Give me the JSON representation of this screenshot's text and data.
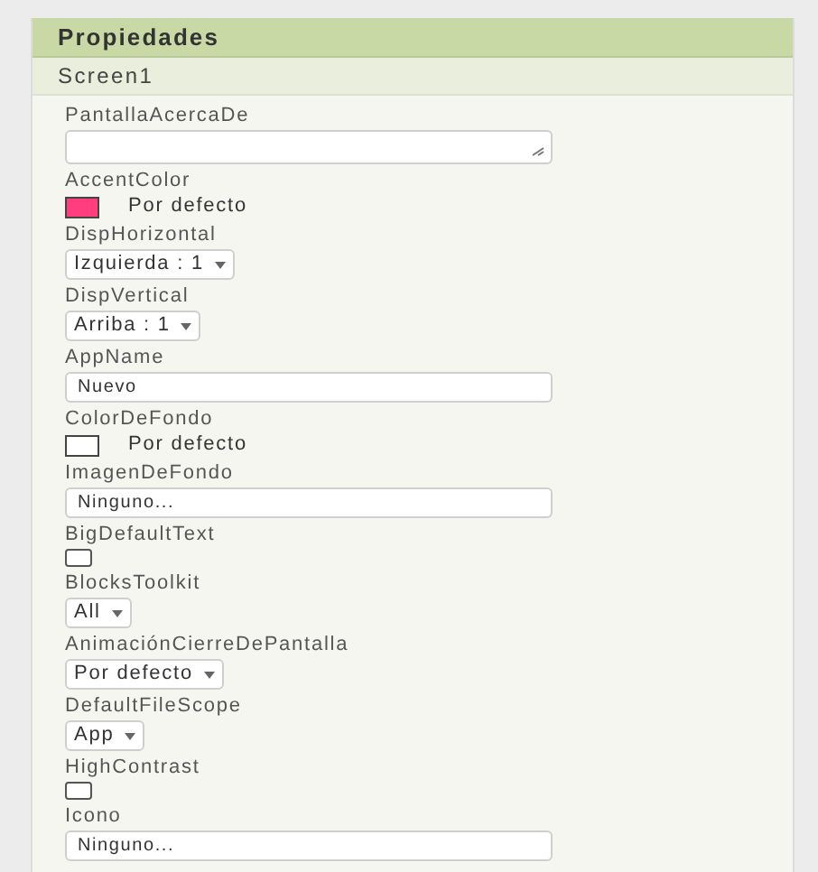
{
  "panel": {
    "title": "Propiedades",
    "component": "Screen1"
  },
  "properties": [
    {
      "kind": "textarea",
      "label": "PantallaAcercaDe"
    },
    {
      "kind": "color",
      "label": "AccentColor",
      "color": "#ff3d7f",
      "value": "Por defecto"
    },
    {
      "kind": "dropdown",
      "label": "DispHorizontal",
      "value": "Izquierda : 1"
    },
    {
      "kind": "dropdown",
      "label": "DispVertical",
      "value": "Arriba : 1"
    },
    {
      "kind": "text",
      "label": "AppName",
      "value": "Nuevo"
    },
    {
      "kind": "color",
      "label": "ColorDeFondo",
      "color": "#ffffff",
      "value": "Por defecto"
    },
    {
      "kind": "text",
      "label": "ImagenDeFondo",
      "value": "Ninguno..."
    },
    {
      "kind": "checkbox",
      "label": "BigDefaultText",
      "checked": false
    },
    {
      "kind": "dropdown",
      "label": "BlocksToolkit",
      "value": "All"
    },
    {
      "kind": "dropdown",
      "label": "AnimaciónCierreDePantalla",
      "value": "Por defecto"
    },
    {
      "kind": "dropdown",
      "label": "DefaultFileScope",
      "value": "App"
    },
    {
      "kind": "checkbox",
      "label": "HighContrast",
      "checked": false
    },
    {
      "kind": "text",
      "label": "Icono",
      "value": "Ninguno..."
    }
  ]
}
